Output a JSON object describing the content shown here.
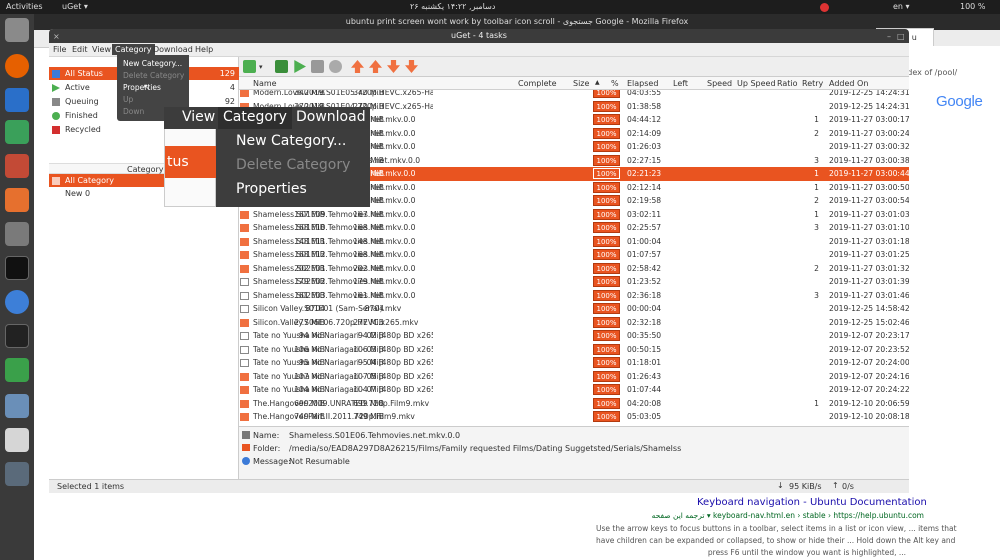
{
  "desktop": {
    "activities": "Activities",
    "app_menu": "uGet ▾",
    "clock": "۲۶ دسامبر, ۱۴:۲۲ یکشنبه",
    "lang": "en ▾",
    "battery": "100 %"
  },
  "firefox": {
    "title": "ubuntu print screen wont work by toolbar icon scroll - جستجوی Google - Mozilla Firefox",
    "tab_label": "Google u",
    "url_fragment": "index of /pool/",
    "google_logo": "Google",
    "result_title": "Keyboard navigation - Ubuntu Documentation",
    "result_url": "ترجمه این صفحه ▾ keyboard-nav.html.en › stable › https://help.ubuntu.com",
    "snippet_1": "Use the arrow keys to focus buttons in a toolbar, select items in a list or icon view, ... items that",
    "snippet_2": "have children can be expanded or collapsed, to show or hide their ... Hold down the Alt key and",
    "snippet_3": "press F6 until the window you want is highlighted, ..."
  },
  "uget": {
    "title": "uGet - 4 tasks",
    "menu": [
      "File",
      "Edit",
      "View",
      "Category",
      "Download",
      "Help"
    ],
    "status_tree": [
      {
        "label": "All Status",
        "count": "129",
        "color": "#3c7bd8"
      },
      {
        "label": "Active",
        "count": "4",
        "color": "#4caf50"
      },
      {
        "label": "Queuing",
        "count": "92",
        "color": "#888888"
      },
      {
        "label": "Finished",
        "count": "",
        "color": "#4caf50"
      },
      {
        "label": "Recycled",
        "count": "",
        "color": "#d32f2f"
      }
    ],
    "category_header": "Category",
    "categories": [
      {
        "label": "All Category"
      },
      {
        "label": "New 0"
      }
    ],
    "category_menu": [
      "New Category...",
      "Delete Category",
      "Properties",
      "Up",
      "Down"
    ],
    "zoom": {
      "menubar": [
        "View",
        "Category",
        "Download"
      ],
      "items": [
        "New Category...",
        "Delete Category",
        "Properties"
      ],
      "status_fragment": "tus"
    },
    "columns": [
      "Name",
      "Complete",
      "Size",
      "%",
      "Elapsed",
      "Left",
      "Speed",
      "Up Speed",
      "Ratio",
      "Retry",
      "Added On"
    ],
    "rows": [
      {
        "name": "Modern.Love.2019.S01E05.720p.HEVC.x265-Hastidl.mkv",
        "complete": "340 MiB",
        "size": "340 MiB",
        "pct": "100%",
        "elapsed": "04:03:55",
        "retry": "",
        "added": "2019-12-25 14:24:31",
        "icon": "ok"
      },
      {
        "name": "Modern.Love.2019.S01E04.720p.HEVC.x265-Hastidl.mkv",
        "complete": "270 MiB",
        "size": "270 MiB",
        "pct": "100%",
        "elapsed": "01:38:58",
        "retry": "",
        "added": "2019-12-25 14:24:31",
        "icon": "ok"
      },
      {
        "name": "Shameless.S01E03.Tehmovies.net.mkv.0.0",
        "complete": "184 MiB",
        "size": "184 MiB",
        "pct": "100%",
        "elapsed": "04:44:12",
        "retry": "1",
        "added": "2019-11-27 03:00:17",
        "icon": "ok"
      },
      {
        "name": "Shameless.S01E04.Tehmovies.net.mkv.0.0",
        "complete": "175 MiB",
        "size": "175 MiB",
        "pct": "100%",
        "elapsed": "02:14:09",
        "retry": "2",
        "added": "2019-11-27 03:00:24",
        "icon": "ok"
      },
      {
        "name": "Shameless.S01E05.Tehmovies.net.mkv.0.0",
        "complete": "141 MiB",
        "size": "141 MiB",
        "pct": "100%",
        "elapsed": "01:26:03",
        "retry": "",
        "added": "2019-11-27 03:00:32",
        "icon": "ok"
      },
      {
        "name": "Shameless.S01E06a.Tehmovies.net.mkv.0.0",
        "complete": "148 MiB",
        "size": "148 MiB",
        "pct": "100%",
        "elapsed": "02:27:15",
        "retry": "3",
        "added": "2019-11-27 03:00:38",
        "icon": "ok"
      },
      {
        "name": "Shameless.S01E06.Tehmovies.net.mkv.0.0",
        "complete": "165 MiB",
        "size": "165 MiB",
        "pct": "100%",
        "elapsed": "02:21:23",
        "retry": "1",
        "added": "2019-11-27 03:00:44",
        "icon": "ok",
        "selected": true
      },
      {
        "name": "Shameless.S01E07.Tehmovies.net.mkv.0.0",
        "complete": "149 MiB",
        "size": "149 MiB",
        "pct": "100%",
        "elapsed": "02:12:14",
        "retry": "1",
        "added": "2019-11-27 03:00:50",
        "icon": "ok"
      },
      {
        "name": "Shameless.S01E08.Tehmovies.net.mkv.0.0",
        "complete": "159 MiB",
        "size": "159 MiB",
        "pct": "100%",
        "elapsed": "02:19:58",
        "retry": "2",
        "added": "2019-11-27 03:00:54",
        "icon": "ok"
      },
      {
        "name": "Shameless.S01E09.Tehmovies.net.mkv.0.0",
        "complete": "167 MiB",
        "size": "167 MiB",
        "pct": "100%",
        "elapsed": "03:02:11",
        "retry": "1",
        "added": "2019-11-27 03:01:03",
        "icon": "ok"
      },
      {
        "name": "Shameless.S01E10.Tehmovies.net.mkv.0.0",
        "complete": "168 MiB",
        "size": "168 MiB",
        "pct": "100%",
        "elapsed": "02:25:57",
        "retry": "3",
        "added": "2019-11-27 03:01:10",
        "icon": "ok"
      },
      {
        "name": "Shameless.S01E11.Tehmovies.net.mkv.0.0",
        "complete": "148 MiB",
        "size": "148 MiB",
        "pct": "100%",
        "elapsed": "01:00:04",
        "retry": "",
        "added": "2019-11-27 03:01:18",
        "icon": "ok"
      },
      {
        "name": "Shameless.S01E12.Tehmovies.net.mkv.0.0",
        "complete": "168 MiB",
        "size": "168 MiB",
        "pct": "100%",
        "elapsed": "01:07:57",
        "retry": "",
        "added": "2019-11-27 03:01:25",
        "icon": "ok"
      },
      {
        "name": "Shameless.S02E01.Tehmovies.net.mkv.0.0",
        "complete": "202 MiB",
        "size": "202 MiB",
        "pct": "100%",
        "elapsed": "02:58:42",
        "retry": "2",
        "added": "2019-11-27 03:01:32",
        "icon": "ok"
      },
      {
        "name": "Shameless.S02E02.Tehmovies.net.mkv.0.0",
        "complete": "179 MiB",
        "size": "179 MiB",
        "pct": "100%",
        "elapsed": "01:23:52",
        "retry": "",
        "added": "2019-11-27 03:01:39",
        "icon": "doc"
      },
      {
        "name": "Shameless.S02E03.Tehmovies.net.mkv.0.0",
        "complete": "161 MiB",
        "size": "161 MiB",
        "pct": "100%",
        "elapsed": "02:36:18",
        "retry": "3",
        "added": "2019-11-27 03:01:46",
        "icon": "doc"
      },
      {
        "name": "Silicon Valley.S01E01 (Sam-Serial).mkv",
        "complete": "8704",
        "size": "8704",
        "pct": "100%",
        "elapsed": "00:00:04",
        "retry": "",
        "added": "2019-12-25 14:58:42",
        "icon": "doc"
      },
      {
        "name": "Silicon.Valley.S06E06.720p.HEVC.x265.mkv",
        "complete": "277 MiB",
        "size": "277 MiB",
        "pct": "100%",
        "elapsed": "02:32:18",
        "retry": "",
        "added": "2019-12-25 15:02:46",
        "icon": "ok"
      },
      {
        "name": "Tate no Yuusha no Nariagari - 02 [480p BD x265] [DA] [10Bit] [AnimDL.ir].mk",
        "complete": "94 MiB",
        "size": "94 MiB",
        "pct": "100%",
        "elapsed": "00:35:50",
        "retry": "",
        "added": "2019-12-07 20:23:17",
        "icon": "doc"
      },
      {
        "name": "Tate no Yuusha no Nariagari - 03 [480p BD x265] [DA] [10Bit] [AnimDL.ir].mk",
        "complete": "106 MiB",
        "size": "106 MiB",
        "pct": "100%",
        "elapsed": "00:50:15",
        "retry": "",
        "added": "2019-12-07 20:23:52",
        "icon": "doc"
      },
      {
        "name": "Tate no Yuusha no Nariagari - 04 [480p BD x265] [DA] [10Bit] [AnimDL.ir].mk",
        "complete": "95 MiB",
        "size": "95 MiB",
        "pct": "100%",
        "elapsed": "01:18:01",
        "retry": "",
        "added": "2019-12-07 20:24:00",
        "icon": "doc"
      },
      {
        "name": "Tate no Yuusha no Nariagari - 05 [480p BD x265] [DA] [10Bit] [AnimDL.ir].mk",
        "complete": "107 MiB",
        "size": "107 MiB",
        "pct": "100%",
        "elapsed": "01:26:43",
        "retry": "",
        "added": "2019-12-07 20:24:16",
        "icon": "ok"
      },
      {
        "name": "Tate no Yuusha no Nariagari - 07 [480p BD x265] [DA] [10Bit] [AnimDL.ir].mk",
        "complete": "104 MiB",
        "size": "104 MiB",
        "pct": "100%",
        "elapsed": "01:07:44",
        "retry": "",
        "added": "2019-12-07 20:24:22",
        "icon": "ok"
      },
      {
        "name": "The.Hangover.2009.UNRATED.720p.Film9.mkv",
        "complete": "699 MiB",
        "size": "699 MiB",
        "pct": "100%",
        "elapsed": "04:20:08",
        "retry": "1",
        "added": "2019-12-10 20:06:59",
        "icon": "ok"
      },
      {
        "name": "The.Hangover.Part.II.2011.720p.Film9.mkv",
        "complete": "749 MiB",
        "size": "749 MiB",
        "pct": "100%",
        "elapsed": "05:03:05",
        "retry": "",
        "added": "2019-12-10 20:08:18",
        "icon": "ok"
      }
    ],
    "details": {
      "name_label": "Name:",
      "name_value": "Shameless.S01E06.Tehmovies.net.mkv.0.0",
      "folder_label": "Folder:",
      "folder_value": "/media/so/EAD8A297D8A26215/Films/Family requested Films/Dating Suggetsted/Serials/Shamelss",
      "message_label": "Message:",
      "message_value": "Not Resumable"
    },
    "status": {
      "selected": "Selected 1 items",
      "down_speed": "95 KiB/s",
      "up_speed": "0/s"
    }
  },
  "colors": {
    "accent": "#e95420",
    "ubuntu_bg": "#2c2c2c"
  }
}
